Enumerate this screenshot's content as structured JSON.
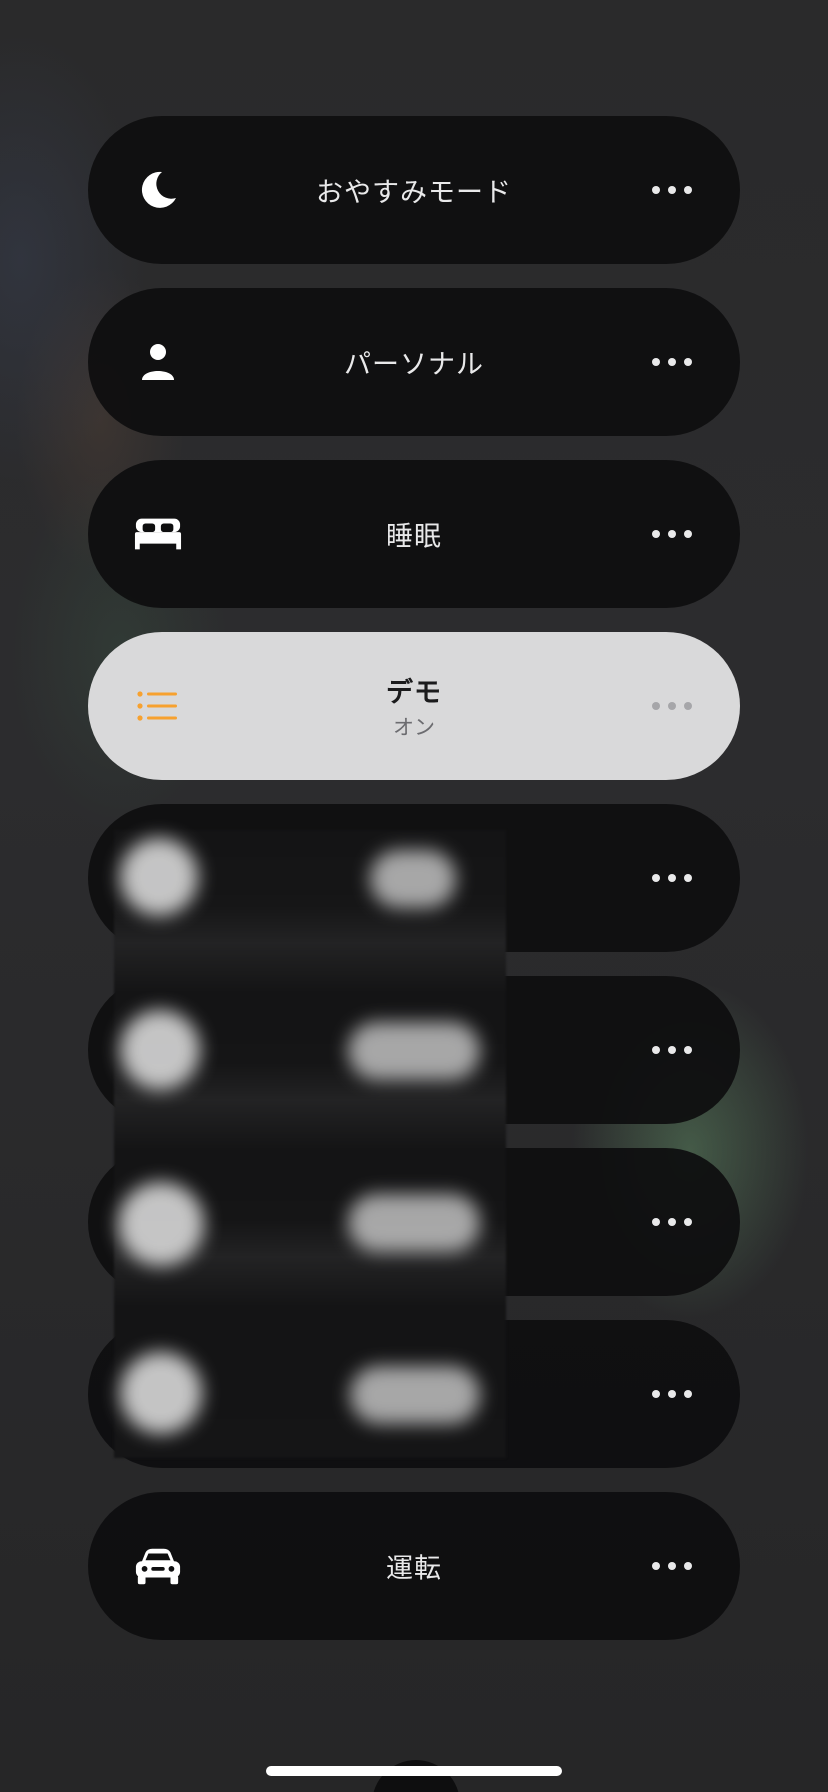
{
  "modes": [
    {
      "id": "sleep-mode",
      "icon": "moon-icon",
      "title": "おやすみモード",
      "subtitle": "",
      "active": false
    },
    {
      "id": "personal",
      "icon": "person-icon",
      "title": "パーソナル",
      "subtitle": "",
      "active": false
    },
    {
      "id": "sleep",
      "icon": "bed-icon",
      "title": "睡眠",
      "subtitle": "",
      "active": false
    },
    {
      "id": "demo",
      "icon": "list-icon",
      "title": "デモ",
      "subtitle": "オン",
      "active": true
    },
    {
      "id": "hidden-1",
      "icon": "blurred-icon",
      "title": "",
      "subtitle": "",
      "active": false
    },
    {
      "id": "hidden-2",
      "icon": "blurred-icon",
      "title": "",
      "subtitle": "",
      "active": false
    },
    {
      "id": "hidden-3",
      "icon": "blurred-icon",
      "title": "",
      "subtitle": "",
      "active": false
    },
    {
      "id": "hidden-4",
      "icon": "blurred-icon",
      "title": "",
      "subtitle": "",
      "active": false
    },
    {
      "id": "driving",
      "icon": "car-icon",
      "title": "運転",
      "subtitle": "",
      "active": false
    }
  ],
  "colors": {
    "pill_background": "#0e0e0f",
    "active_pill_background": "#d9d9da",
    "active_icon": "#f7a12e",
    "text": "#e9e9ea"
  }
}
